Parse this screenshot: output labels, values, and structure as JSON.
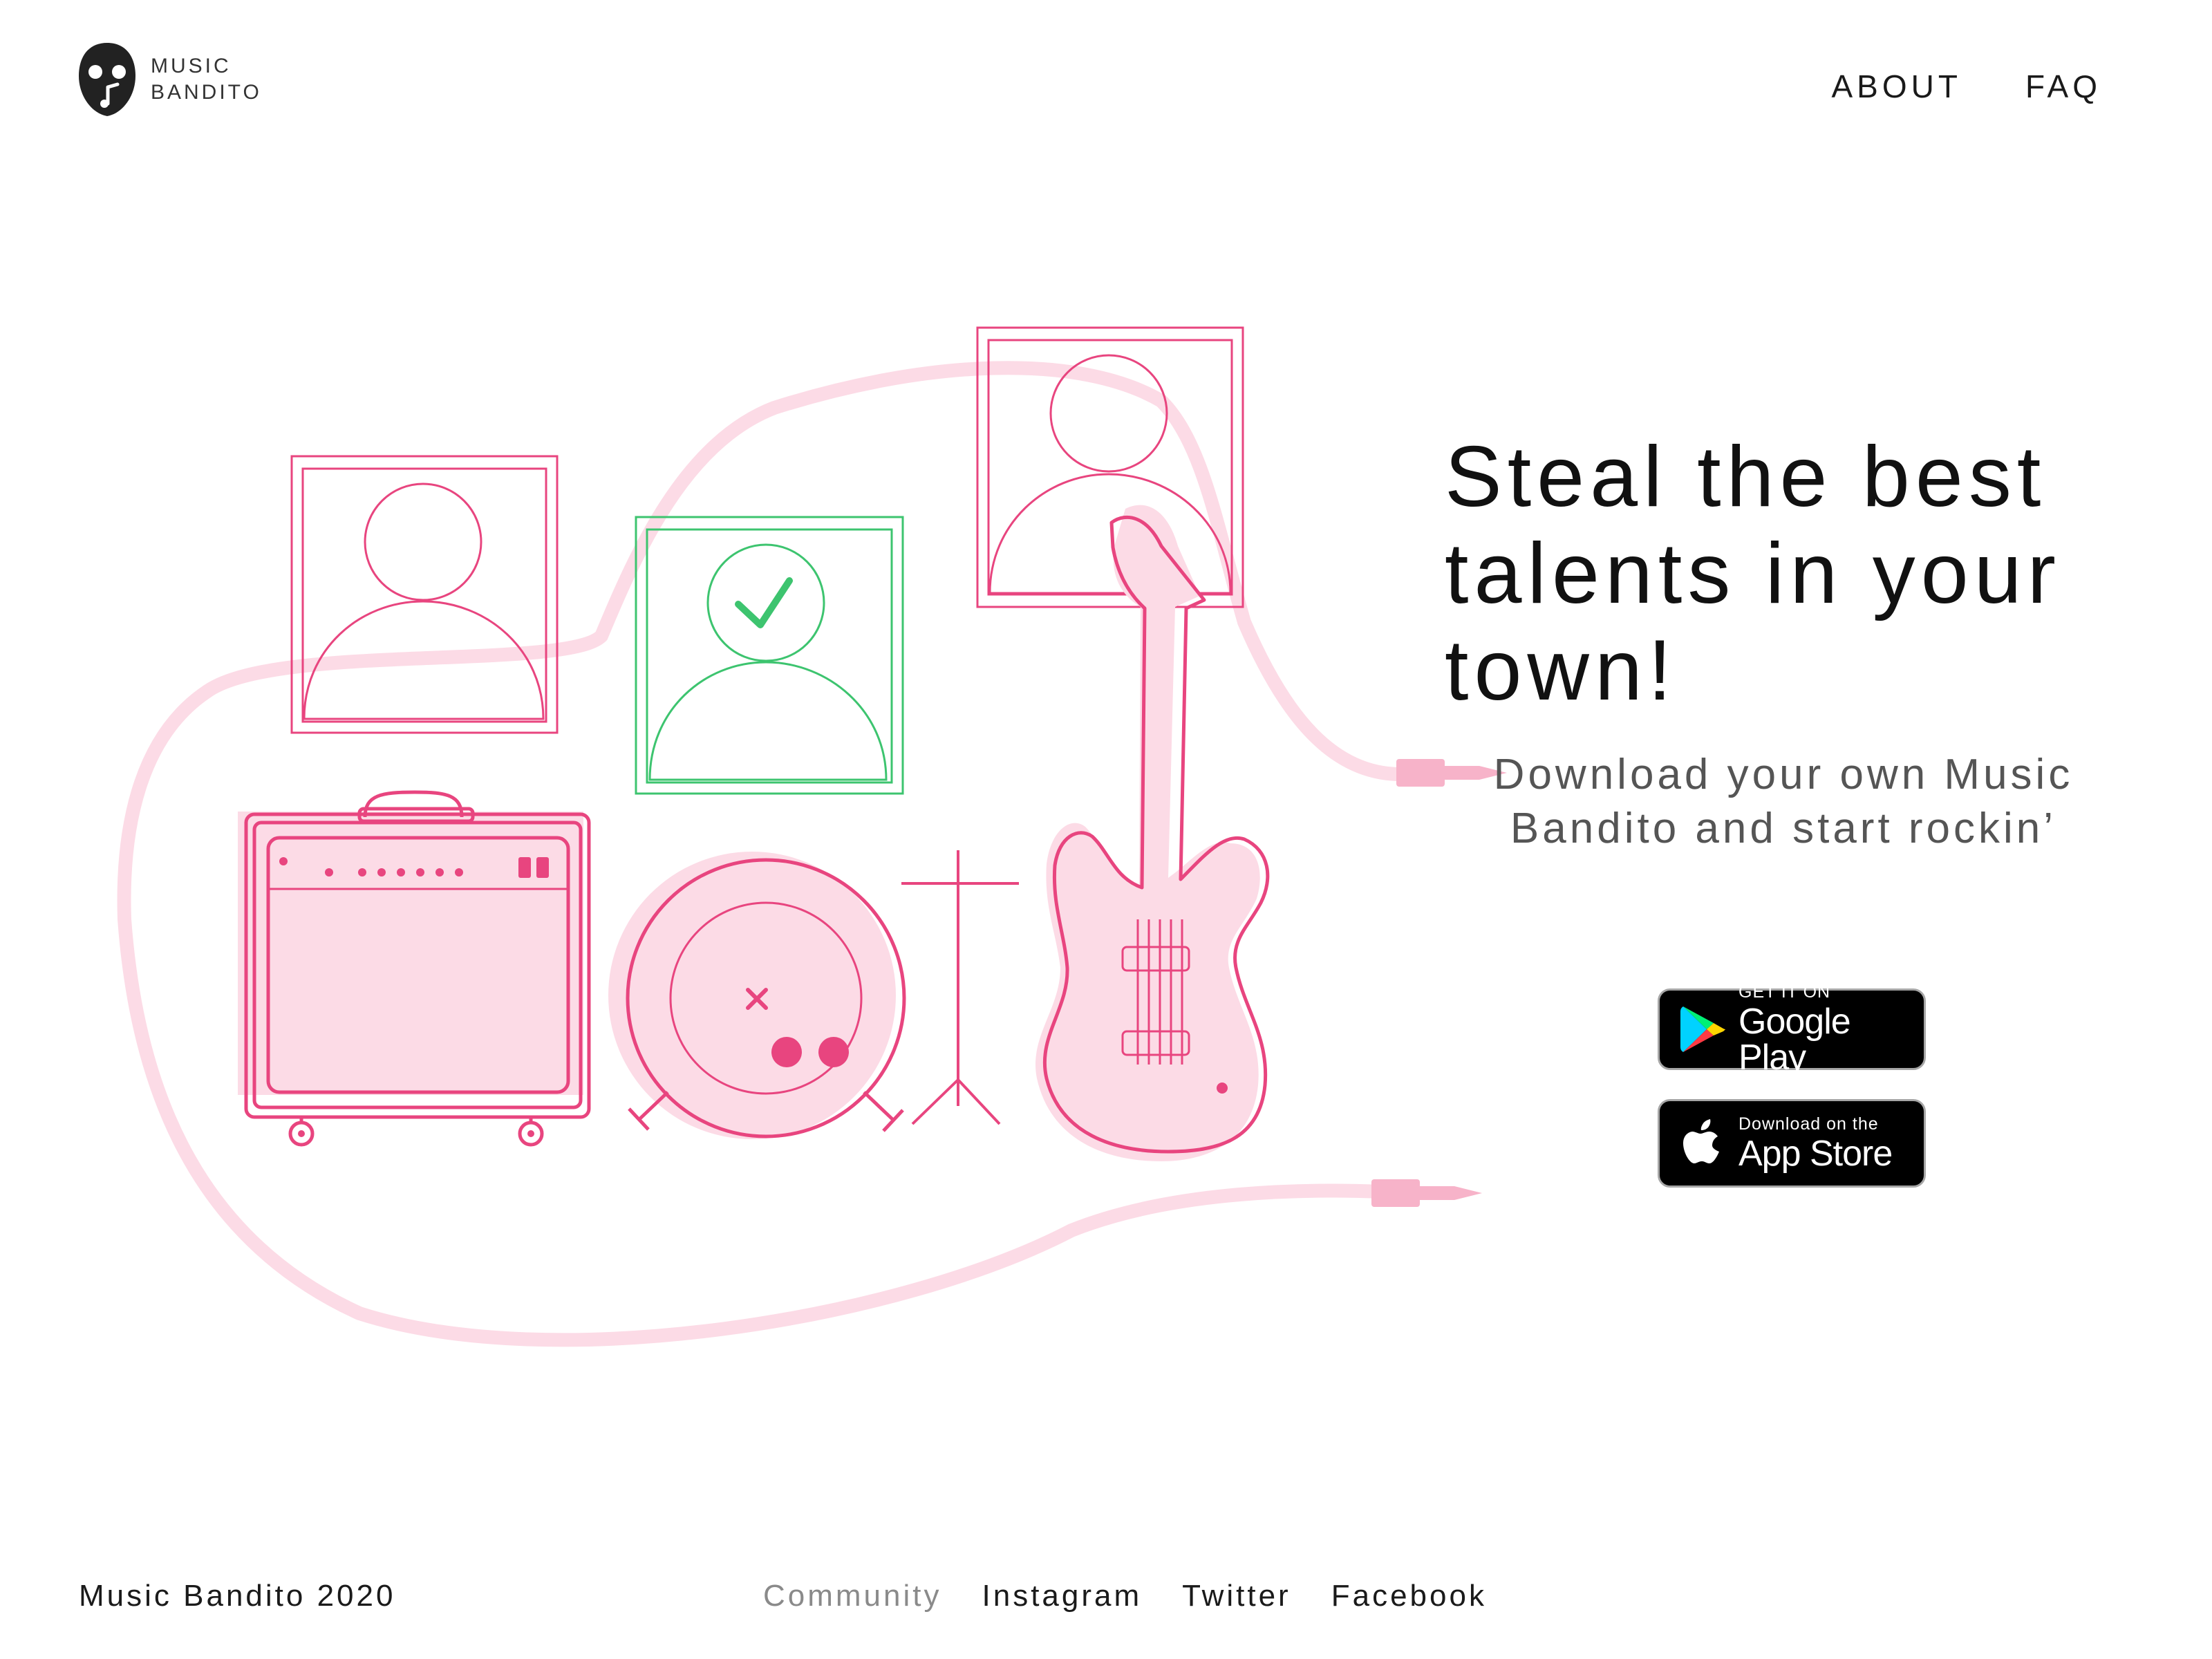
{
  "brand": {
    "line1": "MUSIC",
    "line2": "BANDITO"
  },
  "nav": {
    "items": [
      "ABOUT",
      "FAQ"
    ]
  },
  "hero": {
    "headline": "Steal the best talents in your town!",
    "subtitle": "Download your own Music Bandito and start rockin’"
  },
  "stores": {
    "google": {
      "small": "GET IT ON",
      "big": "Google Play"
    },
    "apple": {
      "small": "Download on the",
      "big": "App Store"
    }
  },
  "footer": {
    "copyright": "Music Bandito 2020",
    "links": [
      "Community",
      "Instagram",
      "Twitter",
      "Facebook"
    ]
  },
  "colors": {
    "accent_pink": "#e8457f",
    "light_pink": "#fcdbe6",
    "cable_pink": "#fde0ea",
    "check_green": "#3dc46f",
    "text_dark": "#111111",
    "text_muted": "#8a8a8a"
  },
  "icons": {
    "logo": "bandit-mask-icon",
    "google": "google-play-icon",
    "apple": "apple-icon"
  }
}
